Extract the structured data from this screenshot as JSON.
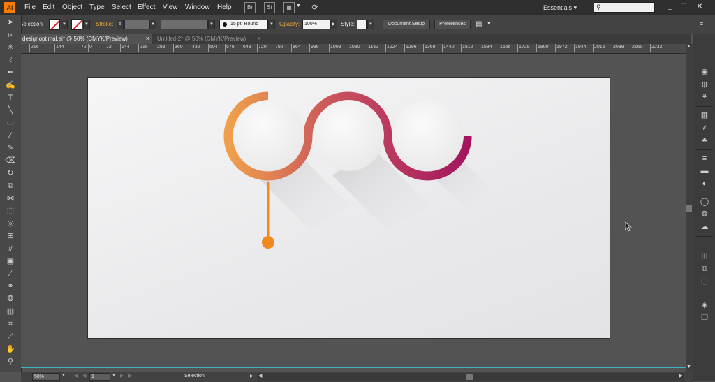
{
  "menubar": {
    "items": [
      "File",
      "Edit",
      "Object",
      "Type",
      "Select",
      "Effect",
      "View",
      "Window",
      "Help"
    ],
    "bridge_label": "Br",
    "stock_label": "St",
    "workspace": "Essentials",
    "search_placeholder": "",
    "window_controls": [
      "_",
      "❐",
      "✕"
    ]
  },
  "control_bar": {
    "tool_label": "Selection",
    "stroke_label": "Stroke:",
    "brush_label": "15 pt. Round",
    "opacity_label": "Opacity:",
    "opacity_value": "100%",
    "style_label": "Style:",
    "document_setup": "Document Setup",
    "preferences": "Preferences"
  },
  "tabs": [
    {
      "label": "designoptimal.ai* @ 50% (CMYK/Preview)",
      "close": "×"
    },
    {
      "label": "Untitled-2* @ 50% (CMYK/Preview)",
      "close": "×"
    }
  ],
  "ruler": {
    "ticks": [
      "216",
      "144",
      "72",
      "0",
      "72",
      "144",
      "216",
      "288",
      "360",
      "432",
      "504",
      "576",
      "648",
      "720",
      "792",
      "864",
      "936",
      "1008",
      "1080",
      "1152",
      "1224",
      "1296",
      "1368",
      "1440",
      "1512",
      "1584",
      "1656",
      "1728",
      "1800",
      "1872",
      "1944",
      "2016",
      "2088",
      "2160",
      "2232"
    ]
  },
  "status": {
    "zoom": "50%",
    "artboard": "1",
    "tool": "Selection"
  },
  "colors": {
    "accent_orange": "#f08a1e",
    "gradient_start": "#f0a04c",
    "gradient_mid": "#c9525d",
    "gradient_end": "#a3165f",
    "guide": "#39b5c4"
  },
  "icons": {
    "tools": [
      "selection-arrow",
      "direct-selection",
      "magic-wand",
      "lasso",
      "pen",
      "curvature",
      "type",
      "line",
      "rectangle",
      "paintbrush",
      "pencil",
      "eraser",
      "rotate",
      "scale",
      "width",
      "free-transform",
      "shape-builder",
      "perspective",
      "mesh",
      "gradient",
      "eyedropper",
      "blend",
      "symbol-sprayer",
      "column-graph",
      "artboard",
      "slice",
      "hand",
      "zoom"
    ],
    "panel": [
      "color",
      "color-guide",
      "libraries",
      "swatches",
      "brushes",
      "symbols",
      "stroke",
      "gradient",
      "transparency",
      "appearance",
      "graphic-styles",
      "align",
      "pathfinder",
      "transform",
      "layers",
      "artboards"
    ]
  }
}
